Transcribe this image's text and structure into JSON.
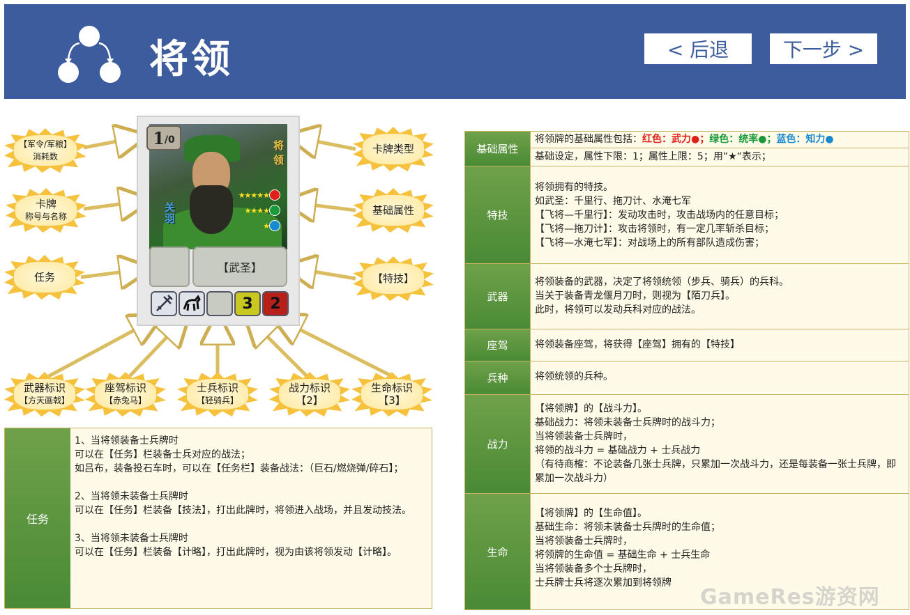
{
  "header": {
    "title": "将领",
    "back_label": "< 后退",
    "next_label": "下一步 >"
  },
  "card": {
    "cost_main": "1",
    "cost_sub": "/0",
    "type_text": "将领",
    "name_text": "关羽",
    "attr_stars": [
      "★★★★★",
      "★★★★",
      "★"
    ],
    "skill_text": "【武圣】",
    "power_value": "3",
    "life_value": "2",
    "colors": {
      "red": "#e0201a",
      "green": "#1a9a3a",
      "blue": "#1a8ad0"
    }
  },
  "labels": {
    "cost": {
      "line1": "【军令/军粮】",
      "line2": "消耗数"
    },
    "type": {
      "line1": "卡牌类型"
    },
    "name": {
      "line1": "卡牌",
      "line2": "称号与名称"
    },
    "attr": {
      "line1": "基础属性"
    },
    "task": {
      "line1": "任务"
    },
    "skill": {
      "line1": "【特技】"
    },
    "weapon": {
      "line1": "武器标识",
      "line2": "【方天画戟】"
    },
    "mount": {
      "line1": "座驾标识",
      "line2": "【赤兔马】"
    },
    "soldier": {
      "line1": "士兵标识",
      "line2": "【轻骑兵】"
    },
    "power": {
      "line1": "战力标识",
      "line2": "【2】"
    },
    "life": {
      "line1": "生命标识",
      "line2": "【3】"
    }
  },
  "task_table": {
    "header": "任务",
    "paragraphs": [
      "1、当将领装备士兵牌时\n可以在【任务】栏装备士兵对应的战法；\n如吕布，装备投石车时，可以在【任务栏】装备战法：（巨石/燃烧弹/碎石】；",
      "2、当将领未装备士兵牌时\n可以在【任务】栏装备【技法】，打出此牌时，将领进入战场，并且发动技法。",
      "3、当将领未装备士兵牌时\n可以在【任务】栏装备【计略】，打出此牌时，视为由该将领发动【计略】。"
    ]
  },
  "right_table": {
    "basic": {
      "header": "基础属性",
      "line1_prefix": "将领牌的基础属性包括：",
      "red": "红色：武力●；",
      "green": "绿色：统率●；",
      "blue": "蓝色：知力●",
      "line2": "基础设定，属性下限：1；属性上限：5；用“★“表示；"
    },
    "skill": {
      "header": "特技",
      "text": "将领拥有的特技。\n如武圣：千里行、拖刀计、水淹七军\n【飞将—千里行】：发动攻击时，攻击战场内的任意目标；\n【飞将—拖刀计】：攻击将领时，有一定几率斩杀目标；\n【飞将—水淹七军】：对战场上的所有部队造成伤害；"
    },
    "weapon": {
      "header": "武器",
      "text": "将领装备的武器，决定了将领统领（步兵、骑兵）的兵科。\n当关于装备青龙偃月刀时，则视为【陌刀兵】。\n此时，将领可以发动兵科对应的战法。"
    },
    "mount": {
      "header": "座驾",
      "text": "将领装备座驾，将获得【座驾】拥有的【特技】"
    },
    "troop": {
      "header": "兵种",
      "text": "将领统领的兵种。"
    },
    "power": {
      "header": "战力",
      "text": "【将领牌】的【战斗力】。\n基础战力：将领未装备士兵牌时的战斗力；\n当将领装备士兵牌时，\n将领的战斗力 = 基础战力 + 士兵战力\n（有待商榷：不论装备几张士兵牌，只累加一次战斗力，还是每装备一张士兵牌，即累加一次战斗力）"
    },
    "life": {
      "header": "生命",
      "text": "【将领牌】的【生命值】。\n基础生命：将领未装备士兵牌时的生命值；\n当将领装备士兵牌时，\n将领牌的生命值 = 基础生命 + 士兵生命\n当将领装备多个士兵牌时，\n士兵牌士兵将逐次累加到将领牌"
    }
  },
  "watermark": "GameRes游资网"
}
